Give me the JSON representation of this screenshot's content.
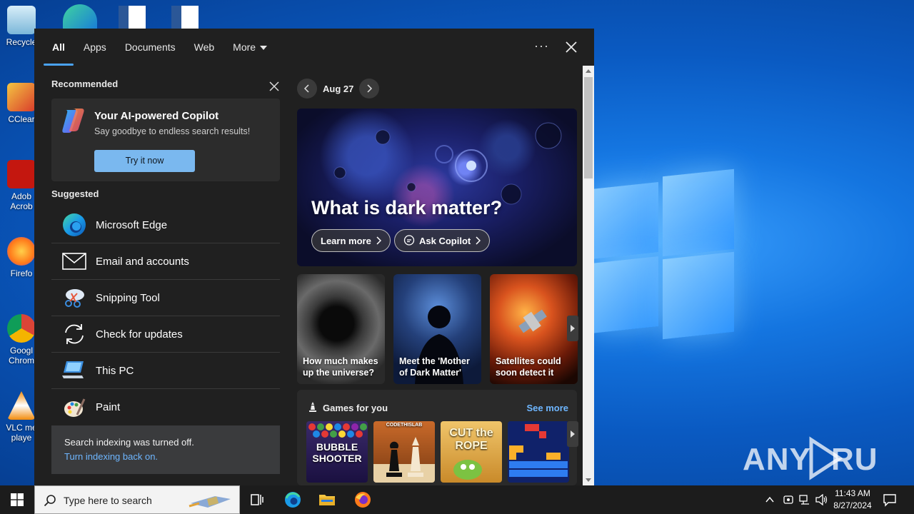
{
  "desktop": {
    "icons": [
      {
        "label": "Recycle",
        "color": "#9fd3f2"
      },
      {
        "label": "CClear",
        "color": "#d93b2b"
      },
      {
        "label": "Adob Acrob",
        "color": "#c4170f"
      },
      {
        "label": "Firefo",
        "color": "#ff7a1a"
      },
      {
        "label": "Googl Chrom",
        "color": "#2a9a4b"
      },
      {
        "label": "VLC me playe",
        "color": "#f28c0d"
      }
    ],
    "watermark": "ANY RUN"
  },
  "search_panel": {
    "tabs": [
      {
        "label": "All",
        "active": true
      },
      {
        "label": "Apps"
      },
      {
        "label": "Documents"
      },
      {
        "label": "Web"
      },
      {
        "label": "More"
      }
    ],
    "recommended": {
      "title": "Recommended",
      "card_title": "Your AI-powered Copilot",
      "card_subtitle": "Say goodbye to endless search results!",
      "button": "Try it now"
    },
    "suggested": {
      "title": "Suggested",
      "items": [
        {
          "label": "Microsoft Edge",
          "icon": "edge-icon"
        },
        {
          "label": "Email and accounts",
          "icon": "mail-icon"
        },
        {
          "label": "Snipping Tool",
          "icon": "snipping-tool-icon"
        },
        {
          "label": "Check for updates",
          "icon": "sync-icon"
        },
        {
          "label": "This PC",
          "icon": "computer-icon"
        },
        {
          "label": "Paint",
          "icon": "palette-icon"
        }
      ]
    },
    "notice": {
      "line1": "Search indexing was turned off.",
      "link": "Turn indexing back on."
    },
    "highlights": {
      "date": "Aug 27",
      "hero_title": "What is dark matter?",
      "learn_more": "Learn more",
      "ask_copilot": "Ask Copilot",
      "cards": [
        {
          "title": "How much makes up the universe?"
        },
        {
          "title": "Meet the 'Mother of Dark Matter'"
        },
        {
          "title": "Satellites could soon detect it"
        }
      ],
      "games_title": "Games for you",
      "see_more": "See more",
      "games": [
        {
          "name": "BUBBLE SHOOTER"
        },
        {
          "name": "CODETHISLAB"
        },
        {
          "name": "CUT the ROPE"
        },
        {
          "name": ""
        }
      ]
    }
  },
  "taskbar": {
    "search_placeholder": "Type here to search",
    "time": "11:43 AM",
    "date": "8/27/2024"
  }
}
